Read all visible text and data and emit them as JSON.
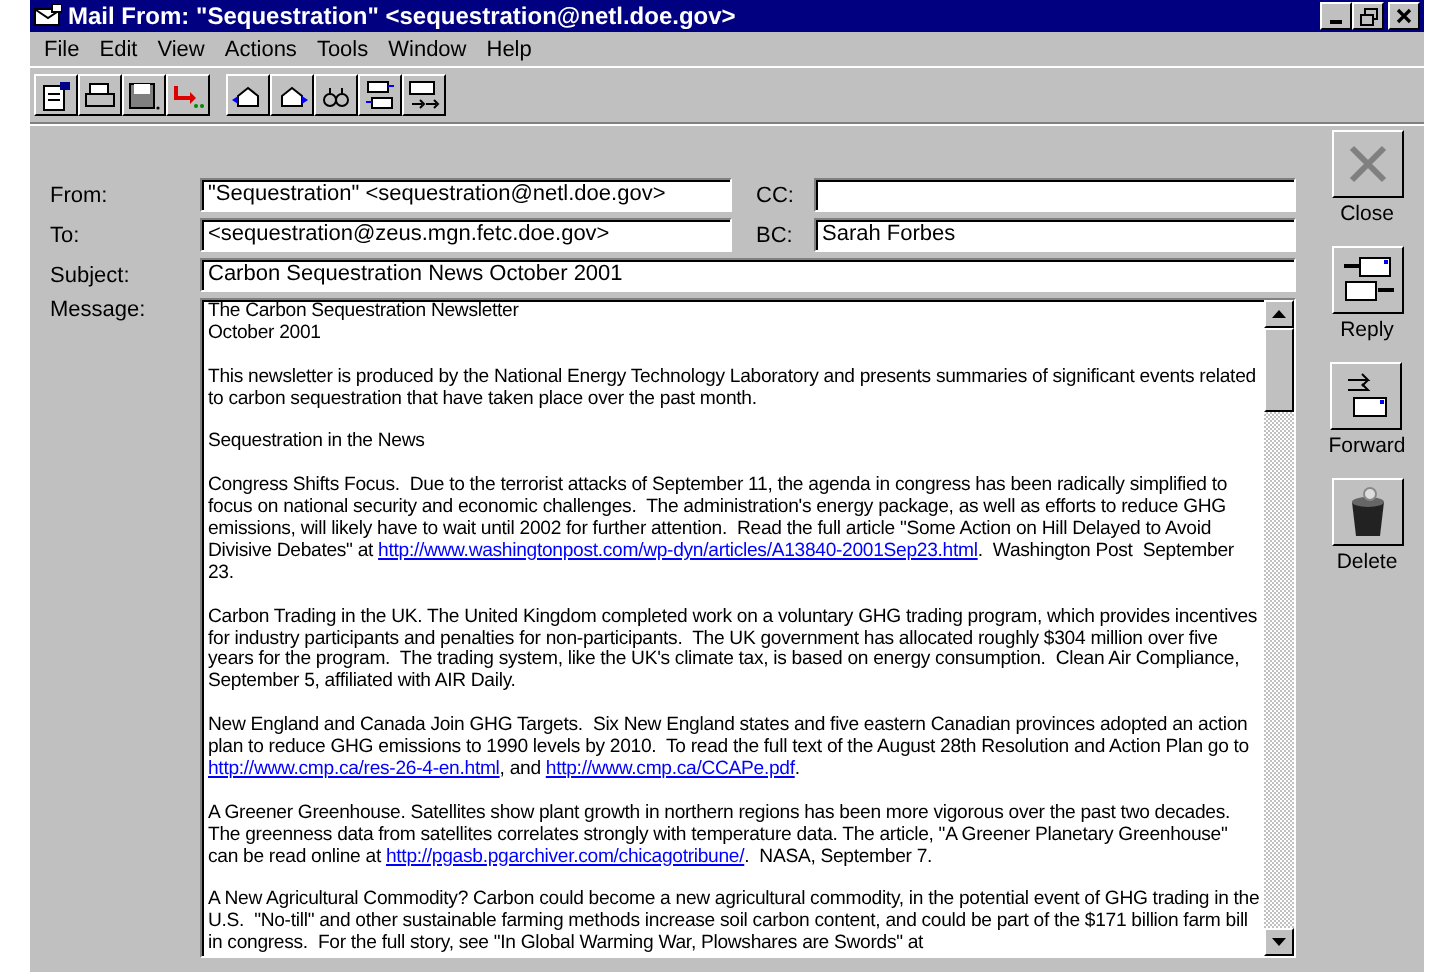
{
  "window": {
    "title": "Mail From: \"Sequestration\" <sequestration@netl.doe.gov>"
  },
  "menu": [
    "File",
    "Edit",
    "View",
    "Actions",
    "Tools",
    "Window",
    "Help"
  ],
  "header": {
    "from": {
      "label": "From:",
      "value": "\"Sequestration\" <sequestration@netl.doe.gov>"
    },
    "to": {
      "label": "To:",
      "value": "<sequestration@zeus.mgn.fetc.doe.gov>"
    },
    "cc": {
      "label": "CC:"
    },
    "bc": {
      "label": "BC:",
      "value": "Sarah Forbes"
    },
    "subject": {
      "label": "Subject:",
      "value": "Carbon Sequestration News October 2001"
    }
  },
  "message": {
    "label": "Message:",
    "paragraphs": [
      [
        {
          "kind": "text",
          "text": "The Carbon Sequestration Newsletter"
        },
        {
          "kind": "break"
        },
        {
          "kind": "text",
          "text": "October 2001"
        }
      ],
      [
        {
          "kind": "text",
          "text": "This newsletter is produced by the National Energy Technology Laboratory and presents summaries of significant events related to carbon sequestration that have taken place over the past month."
        }
      ],
      [
        {
          "kind": "text",
          "text": "Sequestration in the News"
        }
      ],
      [
        {
          "kind": "text",
          "text": "Congress Shifts Focus.  Due to the terrorist attacks of September 11, the agenda in congress has been radically simplified to focus on national security and economic challenges.  The administration's energy package, as well as efforts to reduce GHG emissions, will likely have to wait until 2002 for further attention.  Read the full article \"Some Action on Hill Delayed to Avoid Divisive Debates\" at "
        },
        {
          "kind": "link",
          "text": "http://www.washingtonpost.com/wp-dyn/articles/A13840-2001Sep23.html"
        },
        {
          "kind": "text",
          "text": ".  Washington Post  September 23."
        }
      ],
      [
        {
          "kind": "text",
          "text": "Carbon Trading in the UK. The United Kingdom completed work on a voluntary GHG trading program, which provides incentives for industry participants and penalties for non-participants.  The UK government has allocated roughly $304 million over five years for the program.  The trading system, like the UK's climate tax, is based on energy consumption.  Clean Air Compliance, September 5, affiliated with AIR Daily."
        }
      ],
      [
        {
          "kind": "text",
          "text": "New England and Canada Join GHG Targets.  Six New England states and five eastern Canadian provinces adopted an action plan to reduce GHG emissions to 1990 levels by 2010.  To read the full text of the August 28th Resolution and Action Plan go to "
        },
        {
          "kind": "link",
          "text": "http://www.cmp.ca/res-26-4-en.html"
        },
        {
          "kind": "text",
          "text": ", and "
        },
        {
          "kind": "link",
          "text": "http://www.cmp.ca/CCAPe.pdf"
        },
        {
          "kind": "text",
          "text": "."
        }
      ],
      [
        {
          "kind": "text",
          "text": "A Greener Greenhouse. Satellites show plant growth in northern regions has been more vigorous over the past two decades. The greenness data from satellites correlates strongly with temperature data. The article, \"A Greener Planetary Greenhouse\" can be read online at "
        },
        {
          "kind": "link",
          "text": "http://pgasb.pgarchiver.com/chicagotribune/"
        },
        {
          "kind": "text",
          "text": ".  NASA, September 7."
        }
      ],
      [
        {
          "kind": "text",
          "text": "A New Agricultural Commodity? Carbon could become a new agricultural commodity, in the potential event of GHG trading in the U.S.  \"No-till\" and other sustainable farming methods increase soil carbon content, and could be part of the $171 billion farm bill in congress.  For the full story, see \"In Global Warming War, Plowshares are Swords\" at"
        }
      ]
    ]
  },
  "actions": [
    {
      "kind": "close",
      "label": "Close"
    },
    {
      "kind": "reply",
      "label": "Reply"
    },
    {
      "kind": "forward",
      "label": "Forward"
    },
    {
      "kind": "delete",
      "label": "Delete"
    }
  ]
}
